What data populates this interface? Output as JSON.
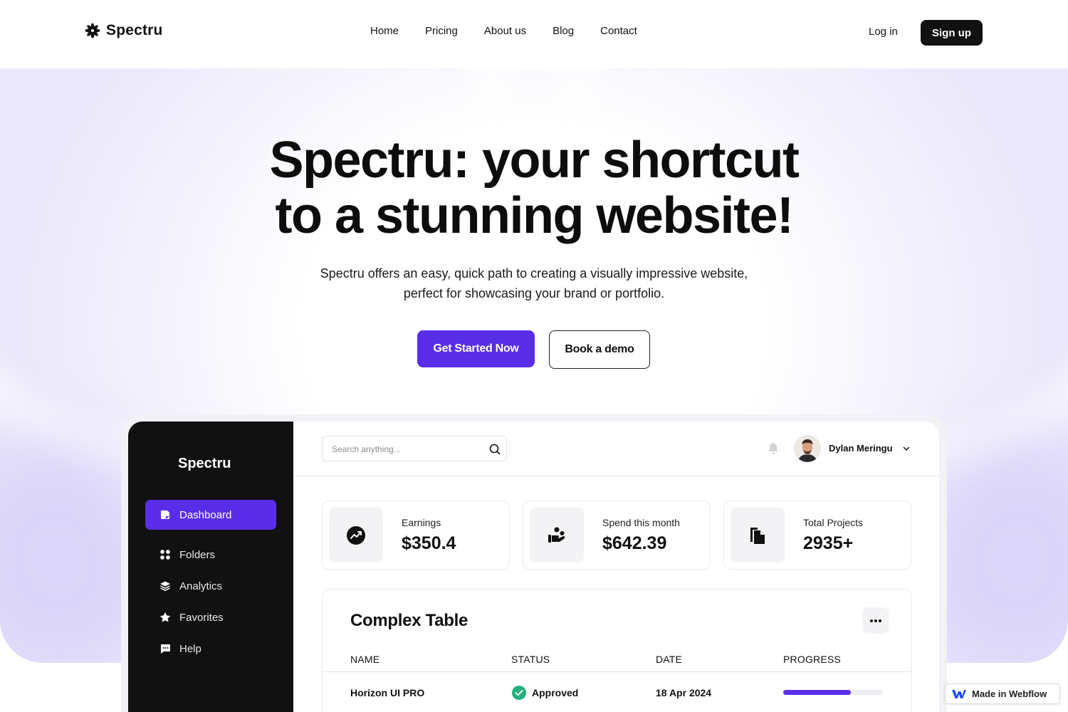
{
  "brand": {
    "name": "Spectru",
    "logo_icon": "asterisk-flower-icon"
  },
  "nav": {
    "links": [
      "Home",
      "Pricing",
      "About us",
      "Blog",
      "Contact"
    ],
    "login": "Log in",
    "signup": "Sign up"
  },
  "hero": {
    "title_line1": "Spectru: your shortcut",
    "title_line2": "to a stunning website!",
    "subtitle_line1": "Spectru offers an easy, quick path to creating a visually impressive website,",
    "subtitle_line2": "perfect for showcasing your brand or portfolio.",
    "primary_cta": "Get Started Now",
    "secondary_cta": "Book a demo"
  },
  "dashboard": {
    "brand": "Spectru",
    "sidebar": [
      {
        "label": "Dashboard",
        "icon": "dashboard-icon",
        "active": true
      },
      {
        "label": "Folders",
        "icon": "folders-grid-icon",
        "active": false
      },
      {
        "label": "Analytics",
        "icon": "layers-icon",
        "active": false
      },
      {
        "label": "Favorites",
        "icon": "star-icon",
        "active": false
      },
      {
        "label": "Help",
        "icon": "chat-bubble-icon",
        "active": false
      }
    ],
    "search": {
      "placeholder": "Search anything...",
      "value": ""
    },
    "user": {
      "name": "Dylan Meringu"
    },
    "stats": [
      {
        "label": "Earnings",
        "value": "$350.4",
        "icon": "trending-up-circle-icon"
      },
      {
        "label": "Spend this month",
        "value": "$642.39",
        "icon": "hand-coins-icon"
      },
      {
        "label": "Total Projects",
        "value": "2935+",
        "icon": "documents-icon"
      }
    ],
    "table": {
      "title": "Complex Table",
      "columns": [
        "NAME",
        "STATUS",
        "DATE",
        "PROGRESS"
      ],
      "rows": [
        {
          "name": "Horizon UI PRO",
          "status": "Approved",
          "date": "18 Apr 2024",
          "progress": 0.68
        }
      ]
    }
  },
  "badge": {
    "label": "Made in Webflow"
  },
  "colors": {
    "accent": "#5a2ee8",
    "dark": "#111111",
    "success": "#22b07d"
  }
}
